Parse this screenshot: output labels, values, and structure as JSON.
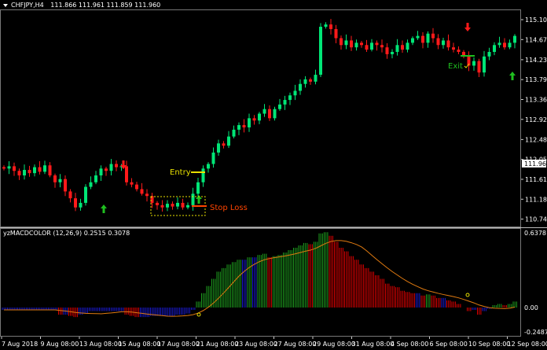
{
  "header": {
    "symbol": "CHFJPY,H4",
    "ohlc": "111.866 111.961 111.859 111.960"
  },
  "indicator": {
    "title": "yzMACDCOLOR (12,26,9) 0.2515 0.3078"
  },
  "annotations": {
    "entry": "Entry",
    "stop_loss": "Stop Loss",
    "exit": "Exit"
  },
  "current_price": "111.960",
  "colors": {
    "bull": "#00e676",
    "bear": "#ff1a1a",
    "entry": "#e8e000",
    "stop": "#ff4500",
    "exit": "#1fbf1f",
    "macd_up": "#1e9e1e",
    "macd_down": "#e00000",
    "macd_flat": "#1a1ad0",
    "signal": "#e07a10"
  },
  "chart_data": [
    {
      "type": "candlestick",
      "title": "CHFJPY,H4",
      "yticks": [
        "115.105",
        "114.670",
        "114.230",
        "113.795",
        "113.360",
        "112.925",
        "112.485",
        "112.050",
        "111.615",
        "111.180",
        "110.745"
      ],
      "ylim": [
        110.5,
        115.45
      ],
      "xticks": [
        "7 Aug 2018",
        "9 Aug 08:00",
        "13 Aug 08:00",
        "15 Aug 08:00",
        "17 Aug 08:00",
        "21 Aug 08:00",
        "23 Aug 08:00",
        "27 Aug 08:00",
        "29 Aug 08:00",
        "31 Aug 08:00",
        "4 Sep 08:00",
        "6 Sep 08:00",
        "10 Sep 08:00",
        "12 Sep 08:00"
      ],
      "close": [
        111.85,
        111.9,
        111.8,
        111.7,
        111.82,
        111.75,
        111.88,
        111.78,
        111.92,
        111.7,
        111.55,
        111.62,
        111.35,
        111.2,
        111.0,
        111.1,
        111.45,
        111.55,
        111.7,
        111.85,
        111.8,
        111.95,
        111.88,
        111.9,
        111.55,
        111.5,
        111.4,
        111.3,
        111.25,
        111.1,
        111.05,
        111.0,
        111.08,
        111.02,
        111.1,
        111.0,
        111.05,
        111.3,
        111.55,
        111.85,
        111.95,
        112.2,
        112.4,
        112.35,
        112.55,
        112.7,
        112.8,
        112.75,
        112.95,
        112.9,
        113.05,
        113.15,
        112.95,
        113.15,
        113.25,
        113.35,
        113.45,
        113.55,
        113.7,
        113.8,
        113.75,
        113.9,
        114.95,
        115.0,
        114.9,
        114.7,
        114.55,
        114.65,
        114.5,
        114.6,
        114.55,
        114.45,
        114.6,
        114.55,
        114.5,
        114.35,
        114.4,
        114.55,
        114.45,
        114.6,
        114.7,
        114.75,
        114.6,
        114.8,
        114.7,
        114.55,
        114.65,
        114.5,
        114.45,
        114.4,
        114.3,
        114.1,
        114.2,
        113.95,
        114.3,
        114.4,
        114.55,
        114.6,
        114.5,
        114.6,
        114.75
      ]
    },
    {
      "type": "bar",
      "title": "yzMACDCOLOR (12,26,9)",
      "yticks": [
        "0.6378",
        "0.00",
        "-0.2487"
      ],
      "ylim": [
        -0.2487,
        0.6378
      ],
      "macd": [
        -0.02,
        -0.02,
        -0.02,
        -0.02,
        -0.02,
        -0.02,
        -0.02,
        -0.02,
        -0.02,
        -0.02,
        -0.02,
        -0.06,
        -0.06,
        -0.07,
        -0.08,
        -0.06,
        -0.05,
        -0.03,
        -0.03,
        -0.03,
        -0.03,
        -0.03,
        -0.03,
        -0.03,
        -0.06,
        -0.07,
        -0.08,
        -0.08,
        -0.08,
        -0.07,
        -0.07,
        -0.07,
        -0.07,
        -0.07,
        -0.06,
        -0.06,
        -0.05,
        -0.02,
        0.05,
        0.12,
        0.18,
        0.24,
        0.3,
        0.33,
        0.36,
        0.38,
        0.4,
        0.4,
        0.42,
        0.42,
        0.44,
        0.45,
        0.42,
        0.43,
        0.44,
        0.46,
        0.48,
        0.5,
        0.52,
        0.54,
        0.53,
        0.55,
        0.62,
        0.63,
        0.6,
        0.55,
        0.5,
        0.47,
        0.43,
        0.4,
        0.36,
        0.33,
        0.3,
        0.27,
        0.24,
        0.2,
        0.18,
        0.17,
        0.14,
        0.13,
        0.12,
        0.12,
        0.1,
        0.11,
        0.1,
        0.08,
        0.08,
        0.06,
        0.05,
        0.03,
        0.0,
        -0.03,
        -0.02,
        -0.06,
        -0.03,
        -0.01,
        0.02,
        0.03,
        0.02,
        0.03,
        0.05
      ]
    }
  ]
}
